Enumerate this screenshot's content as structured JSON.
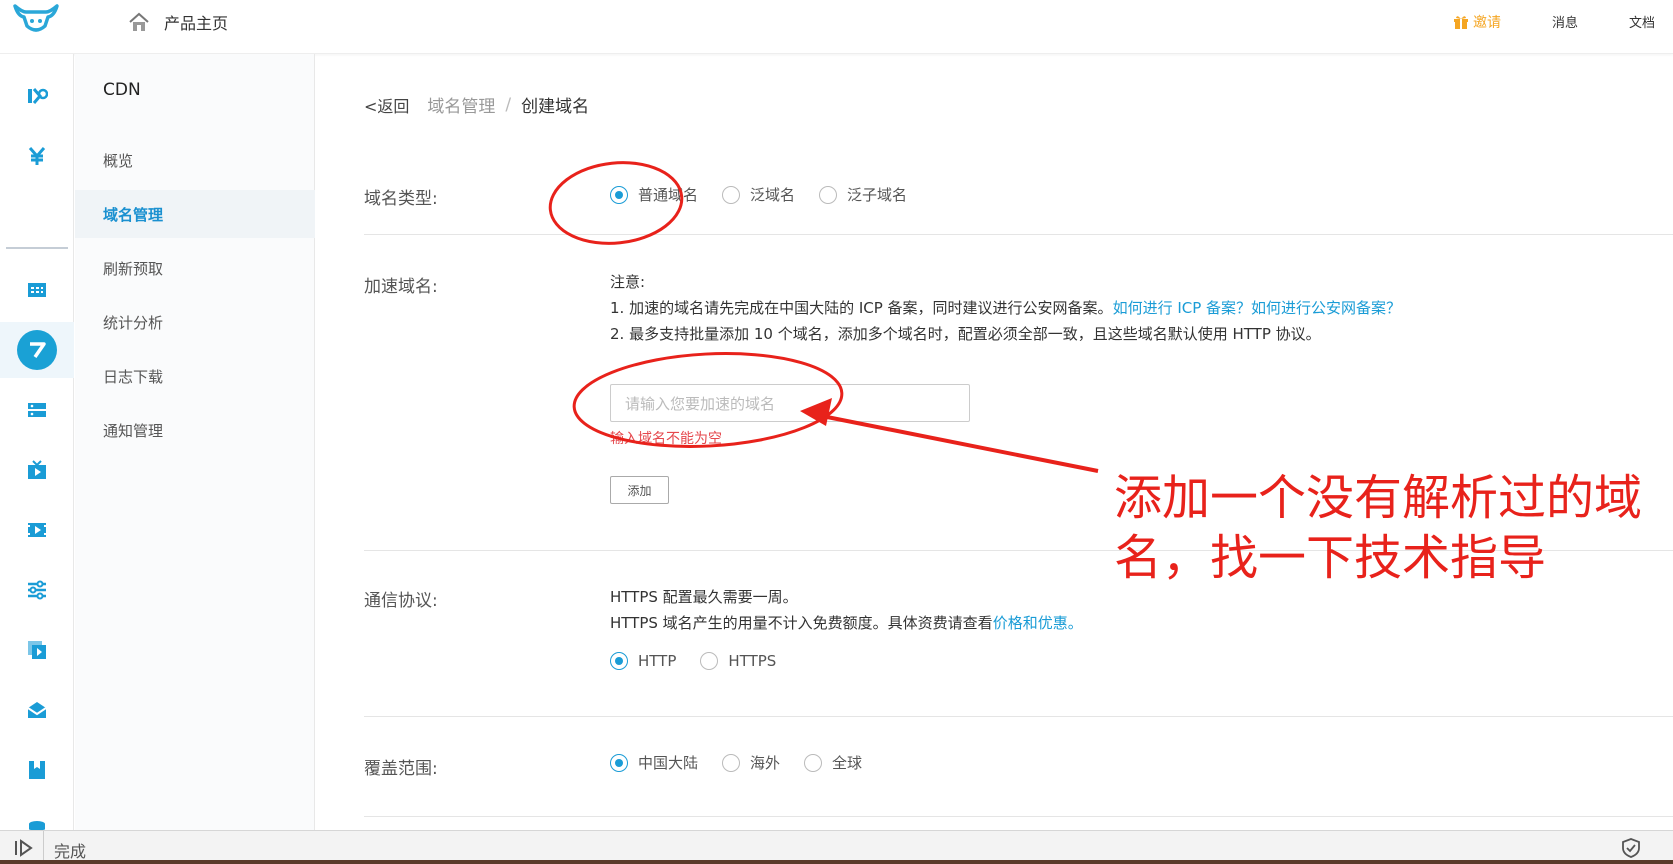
{
  "header": {
    "home_label": "产品主页",
    "invite_label": "邀请",
    "messages_label": "消息",
    "docs_label": "文档"
  },
  "sidebar": {
    "title": "CDN",
    "items": [
      {
        "label": "概览"
      },
      {
        "label": "域名管理",
        "active": true
      },
      {
        "label": "刷新预取"
      },
      {
        "label": "统计分析"
      },
      {
        "label": "日志下载"
      },
      {
        "label": "通知管理"
      }
    ]
  },
  "breadcrumb": {
    "back": "<返回",
    "parent": "域名管理",
    "separator": "/",
    "current": "创建域名"
  },
  "form": {
    "domain_type": {
      "label": "域名类型:",
      "options": [
        "普通域名",
        "泛域名",
        "泛子域名"
      ],
      "selected": "普通域名"
    },
    "accel_domain": {
      "label": "加速域名:",
      "note_title": "注意:",
      "note_1": "1. 加速的域名请先完成在中国大陆的 ICP 备案，同时建议进行公安网备案。",
      "note_1_link": "如何进行 ICP 备案？如何进行公安网备案？",
      "note_2": "2. 最多支持批量添加 10 个域名，添加多个域名时，配置必须全部一致，且这些域名默认使用 HTTP 协议。",
      "placeholder": "请输入您要加速的域名",
      "value": "",
      "error": "输入域名不能为空",
      "add_button": "添加"
    },
    "protocol": {
      "label": "通信协议:",
      "note_1": "HTTPS 配置最久需要一周。",
      "note_2": "HTTPS 域名产生的用量不计入免费额度。具体资费请查看",
      "note_2_link": "价格和优惠。",
      "options": [
        "HTTP",
        "HTTPS"
      ],
      "selected": "HTTP"
    },
    "coverage": {
      "label": "覆盖范围:",
      "options": [
        "中国大陆",
        "海外",
        "全球"
      ],
      "selected": "中国大陆"
    }
  },
  "annotation": {
    "text": "添加一个没有解析过的域名，找一下技术指导",
    "color": "#e8221b"
  },
  "statusbar": {
    "text": "完成"
  },
  "colors": {
    "accent": "#1a9cd6",
    "error": "#e5484d",
    "invite": "#f5a623"
  }
}
